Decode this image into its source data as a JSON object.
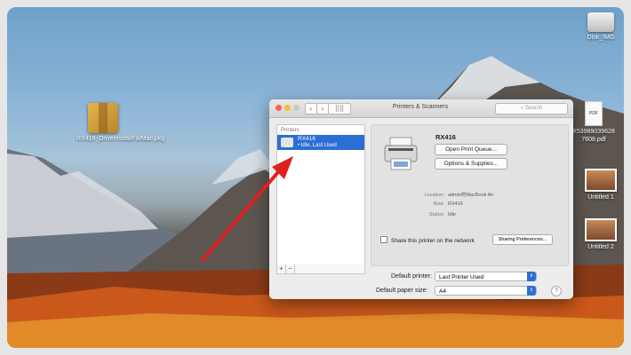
{
  "desktop": {
    "icons": [
      {
        "label": "RX416_DriverInstallForMac.pkg"
      },
      {
        "label": "Disk_IMG"
      },
      {
        "label": "X53989039628 7608.pdf"
      },
      {
        "label": "Untitled 1"
      },
      {
        "label": "Untitled 2"
      }
    ]
  },
  "window": {
    "title": "Printers & Scanners",
    "grid_label": "⣿⣿",
    "search_placeholder": "Search",
    "printers_header": "Printers",
    "printer": {
      "name": "RX416",
      "status": "• Idle, Last Used"
    },
    "add_label": "+",
    "remove_label": "−",
    "detail": {
      "name": "RX416",
      "open_queue": "Open Print Queue...",
      "options": "Options & Supplies...",
      "location_label": "Location:",
      "location_value": "admin的MacBook Air",
      "kind_label": "Kind:",
      "kind_value": "RX416",
      "status_label": "Status:",
      "status_value": "Idle",
      "share_label": "Share this printer on the network",
      "sharing_prefs": "Sharing Preferences..."
    },
    "default_printer_label": "Default printer:",
    "default_printer_value": "Last Printer Used",
    "default_paper_label": "Default paper size:",
    "default_paper_value": "A4",
    "help": "?"
  },
  "colors": {
    "accent": "#2c6fd4",
    "arrow": "#e02020"
  }
}
